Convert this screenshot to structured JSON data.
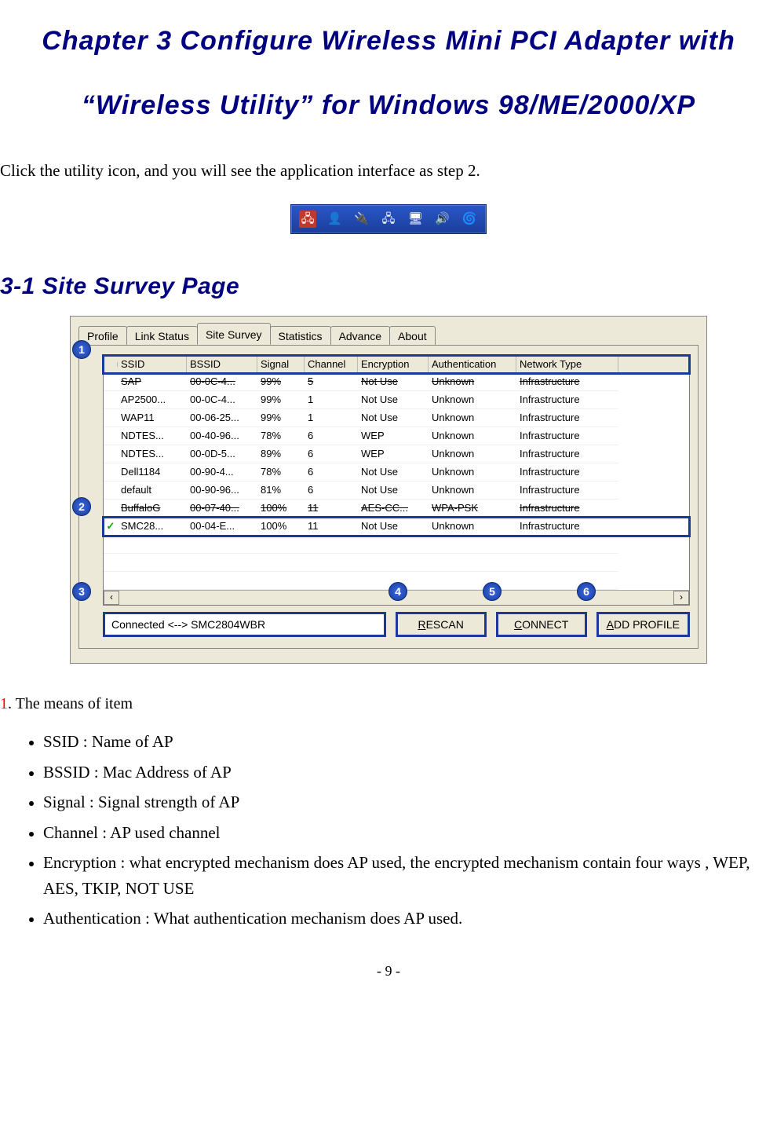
{
  "chapter_title_line1": "Chapter 3    Configure Wireless Mini PCI Adapter with",
  "chapter_title_line2": "“Wireless Utility” for Windows 98/ME/2000/XP",
  "intro": "Click the utility icon, and you will see the application interface as step 2.",
  "section_title": "3-1    Site Survey Page",
  "tabs": [
    "Profile",
    "Link Status",
    "Site Survey",
    "Statistics",
    "Advance",
    "About"
  ],
  "active_tab_index": 2,
  "columns": [
    "",
    "SSID",
    "BSSID",
    "Signal",
    "Channel",
    "Encryption",
    "Authentication",
    "Network Type"
  ],
  "rows": [
    {
      "icon": "",
      "ssid": "SAP",
      "bssid": "00-0C-4...",
      "signal": "99%",
      "channel": "5",
      "enc": "Not Use",
      "auth": "Unknown",
      "ntype": "Infrastructure",
      "struck": true
    },
    {
      "icon": "",
      "ssid": "AP2500...",
      "bssid": "00-0C-4...",
      "signal": "99%",
      "channel": "1",
      "enc": "Not Use",
      "auth": "Unknown",
      "ntype": "Infrastructure"
    },
    {
      "icon": "",
      "ssid": "WAP11",
      "bssid": "00-06-25...",
      "signal": "99%",
      "channel": "1",
      "enc": "Not Use",
      "auth": "Unknown",
      "ntype": "Infrastructure"
    },
    {
      "icon": "",
      "ssid": "NDTES...",
      "bssid": "00-40-96...",
      "signal": "78%",
      "channel": "6",
      "enc": "WEP",
      "auth": "Unknown",
      "ntype": "Infrastructure"
    },
    {
      "icon": "",
      "ssid": "NDTES...",
      "bssid": "00-0D-5...",
      "signal": "89%",
      "channel": "6",
      "enc": "WEP",
      "auth": "Unknown",
      "ntype": "Infrastructure"
    },
    {
      "icon": "",
      "ssid": "Dell1184",
      "bssid": "00-90-4...",
      "signal": "78%",
      "channel": "6",
      "enc": "Not Use",
      "auth": "Unknown",
      "ntype": "Infrastructure"
    },
    {
      "icon": "",
      "ssid": "default",
      "bssid": "00-90-96...",
      "signal": "81%",
      "channel": "6",
      "enc": "Not Use",
      "auth": "Unknown",
      "ntype": "Infrastructure"
    },
    {
      "icon": "",
      "ssid": "BuffaloG",
      "bssid": "00-07-40...",
      "signal": "100%",
      "channel": "11",
      "enc": "AES-CC...",
      "auth": "WPA-PSK",
      "ntype": "Infrastructure",
      "struck": true
    },
    {
      "icon": "conn",
      "ssid": "SMC28...",
      "bssid": "00-04-E...",
      "signal": "100%",
      "channel": "11",
      "enc": "Not Use",
      "auth": "Unknown",
      "ntype": "Infrastructure"
    }
  ],
  "blank_rows": 3,
  "status_text": "Connected <--> SMC2804WBR",
  "buttons": {
    "rescan": "RESCAN",
    "connect": "CONNECT",
    "add_profile": "ADD PROFILE"
  },
  "callouts": [
    "1",
    "2",
    "3",
    "4",
    "5",
    "6"
  ],
  "list_heading_num": "1",
  "list_heading_text": ". The means of item",
  "bullets": [
    "SSID : Name of AP",
    "BSSID : Mac Address of AP",
    "Signal : Signal strength of AP",
    "Channel : AP used channel",
    "Encryption : what encrypted mechanism does AP used, the encrypted mechanism contain four ways , WEP, AES, TKIP, NOT USE",
    "Authentication : What authentication mechanism does AP used."
  ],
  "page_number": "- 9 -"
}
